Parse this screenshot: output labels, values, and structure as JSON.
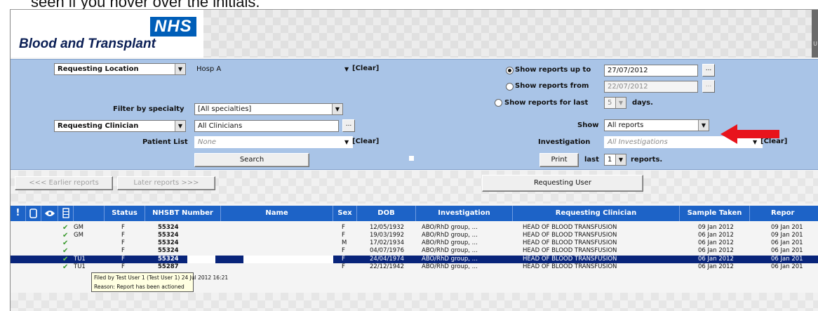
{
  "caption": "seen if you hover over the initials.",
  "header": {
    "logo": "NHS",
    "org_name": "Blood and Transplant",
    "right_edge_text": "U"
  },
  "filters": {
    "location_type": "Requesting Location",
    "location_value": "Hosp A",
    "clear_label": "[Clear]",
    "specialty_label": "Filter by specialty",
    "specialty_value": "[All specialties]",
    "clinician_type": "Requesting Clinician",
    "clinician_value": "All Clinicians",
    "patient_list_label": "Patient List",
    "patient_list_value": "None",
    "search_button": "Search",
    "date_option_1": "Show reports up to",
    "date_value_1": "27/07/2012",
    "date_option_2": "Show reports from",
    "date_value_2": "22/07/2012",
    "date_option_3": "Show reports for last",
    "days_value": "5",
    "days_label": "days.",
    "show_label": "Show",
    "show_value": "All reports",
    "investigation_label": "Investigation",
    "investigation_value": "All Investigations",
    "print_button": "Print",
    "last_label": "last",
    "last_value": "1",
    "reports_label": "reports.",
    "dots": "...",
    "arrow_color": "#e8141c"
  },
  "toolbar": {
    "earlier": "<<< Earlier reports",
    "later": "Later reports >>>",
    "requesting_user": "Requesting User"
  },
  "table": {
    "headers": {
      "flag": "!",
      "status": "Status",
      "nhsbt": "NHSBT Number",
      "name": "Name",
      "sex": "Sex",
      "dob": "DOB",
      "investigation": "Investigation",
      "clinician": "Requesting Clinician",
      "sample": "Sample Taken",
      "report": "Repor"
    },
    "rows": [
      {
        "check": "✔",
        "user": "GM",
        "status": "F",
        "nhsbt": "55324",
        "sex": "F",
        "dob": "12/05/1932",
        "investigation": "ABO/RhD group, ...",
        "clinician": "HEAD OF BLOOD TRANSFUSION",
        "sample": "09 Jan 2012",
        "report": "09 Jan 201"
      },
      {
        "check": "✔",
        "user": "GM",
        "status": "F",
        "nhsbt": "55324",
        "sex": "F",
        "dob": "19/03/1992",
        "investigation": "ABO/RhD group, ...",
        "clinician": "HEAD OF BLOOD TRANSFUSION",
        "sample": "06 Jan 2012",
        "report": "09 Jan 201"
      },
      {
        "check": "✔",
        "user": "",
        "status": "F",
        "nhsbt": "55324",
        "sex": "M",
        "dob": "17/02/1934",
        "investigation": "ABO/RhD group, ...",
        "clinician": "HEAD OF BLOOD TRANSFUSION",
        "sample": "06 Jan 2012",
        "report": "06 Jan 201"
      },
      {
        "check": "✔",
        "user": "",
        "status": "F",
        "nhsbt": "55324",
        "sex": "F",
        "dob": "04/07/1976",
        "investigation": "ABO/RhD group, ...",
        "clinician": "HEAD OF BLOOD TRANSFUSION",
        "sample": "06 Jan 2012",
        "report": "06 Jan 201"
      },
      {
        "check": "✔",
        "user": "TU1",
        "status": "F",
        "nhsbt": "55324",
        "sex": "F",
        "dob": "24/04/1974",
        "investigation": "ABO/RhD group, ...",
        "clinician": "HEAD OF BLOOD TRANSFUSION",
        "sample": "06 Jan 2012",
        "report": "06 Jan 201"
      },
      {
        "check": "✔",
        "user": "TU1",
        "status": "F",
        "nhsbt": "55287",
        "sex": "F",
        "dob": "22/12/1942",
        "investigation": "ABO/RhD group, ...",
        "clinician": "HEAD OF BLOOD TRANSFUSION",
        "sample": "06 Jan 2012",
        "report": "06 Jan 201"
      }
    ]
  },
  "tooltip": {
    "line1": "Filed by Test User 1 (Test User 1) 24 Jul 2012 16:21",
    "line2": "Reason: Report has been actioned"
  }
}
